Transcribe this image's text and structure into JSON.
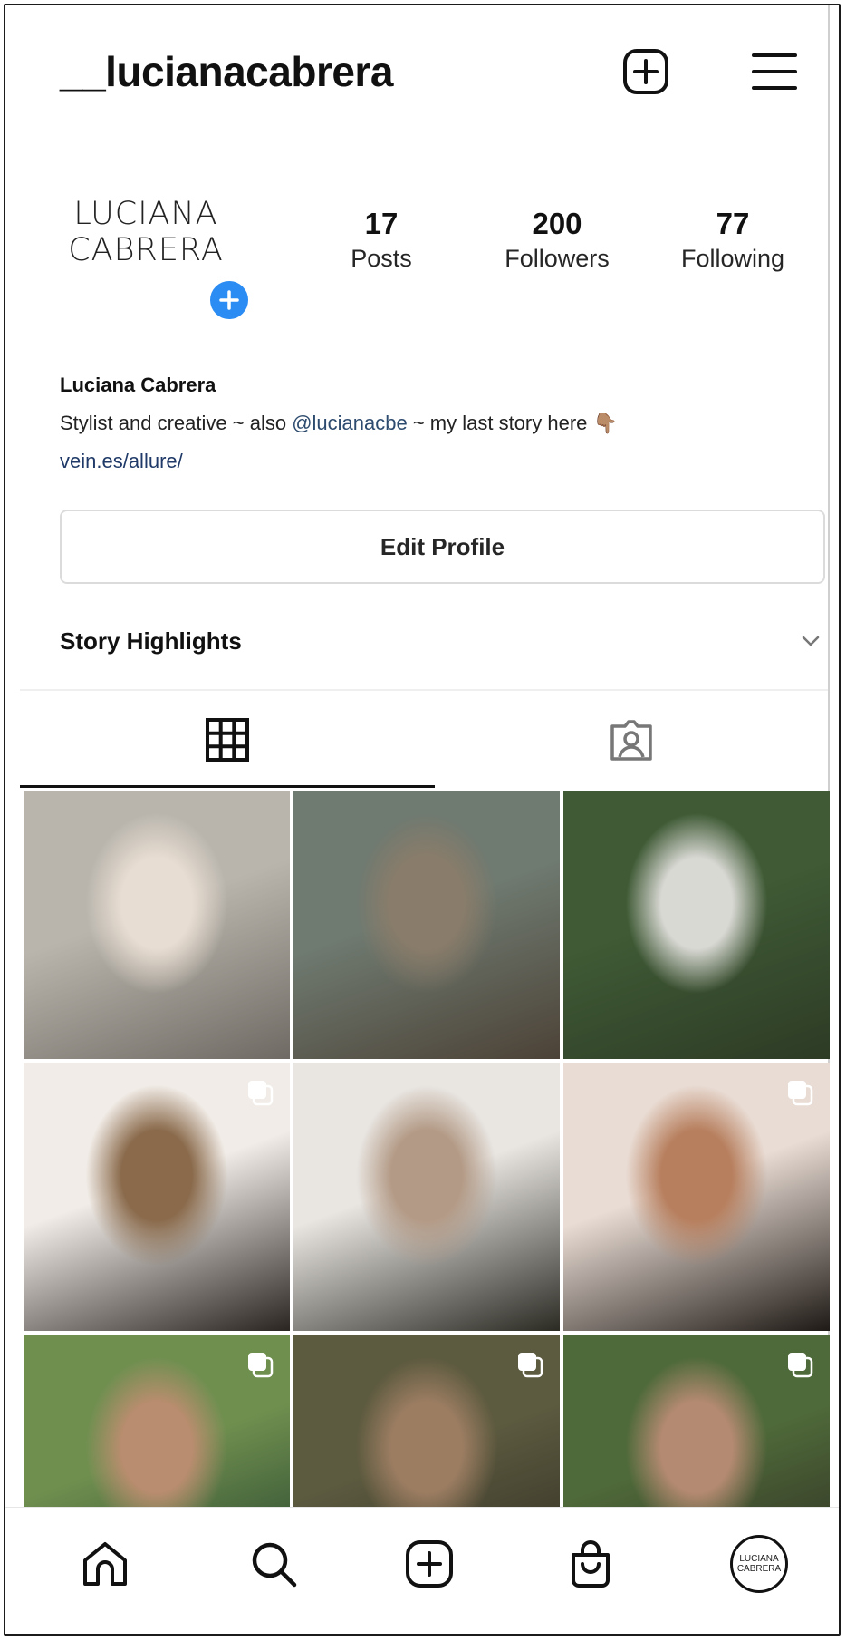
{
  "header": {
    "username": "__lucianacabrera",
    "new_post_icon": "plus-square-icon",
    "menu_icon": "hamburger-menu-icon"
  },
  "profile": {
    "logo_line1": "LUCIANA",
    "logo_line2": "CABRERA",
    "add_story_icon": "plus-circle-icon",
    "stats": [
      {
        "value": "17",
        "label": "Posts"
      },
      {
        "value": "200",
        "label": "Followers"
      },
      {
        "value": "77",
        "label": "Following"
      }
    ],
    "full_name": "Luciana Cabrera",
    "bio_prefix": "Stylist and creative ~ also ",
    "bio_mention": "@lucianacbe",
    "bio_suffix": " ~ my last story here 👇🏽",
    "link": "vein.es/allure/",
    "edit_button": "Edit Profile",
    "highlights_label": "Story Highlights"
  },
  "tabs": [
    {
      "icon": "grid-icon",
      "active": true
    },
    {
      "icon": "tagged-person-icon",
      "active": false
    }
  ],
  "grid": [
    {
      "colors": [
        "#b9b5ad",
        "#e8ddd2",
        "#6f6a63"
      ],
      "multi": false
    },
    {
      "colors": [
        "#6f7a70",
        "#8a7c6a",
        "#4c4237"
      ],
      "multi": false
    },
    {
      "colors": [
        "#3f5a35",
        "#d9d9d4",
        "#2d3b25"
      ],
      "multi": false
    },
    {
      "colors": [
        "#f1ece7",
        "#8a6a4b",
        "#2a2520"
      ],
      "multi": true
    },
    {
      "colors": [
        "#e9e6e2",
        "#b39a86",
        "#2b2a23"
      ],
      "multi": false
    },
    {
      "colors": [
        "#e9dcd4",
        "#b77f5e",
        "#1f1a16"
      ],
      "multi": true
    },
    {
      "colors": [
        "#6f8f4f",
        "#b98d6f",
        "#1e3b2a"
      ],
      "multi": true
    },
    {
      "colors": [
        "#5c5a3f",
        "#9c7d62",
        "#2e2a21"
      ],
      "multi": true
    },
    {
      "colors": [
        "#4f6a3a",
        "#b58a72",
        "#2b271f"
      ],
      "multi": true
    }
  ],
  "nav": {
    "home_icon": "home-icon",
    "search_icon": "search-icon",
    "add_icon": "plus-square-icon",
    "shop_icon": "shopping-bag-icon",
    "avatar_line1": "LUCIANA",
    "avatar_line2": "CABRERA"
  }
}
